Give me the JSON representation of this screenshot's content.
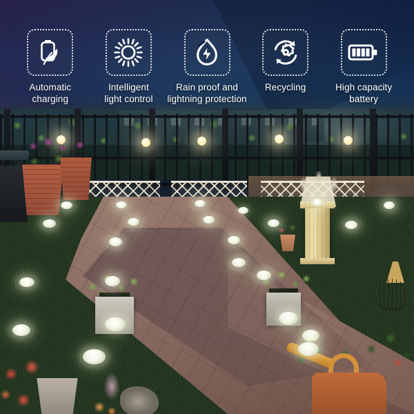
{
  "banner": {
    "type": "product-feature-banner",
    "product_context": "solar garden ground lights at night",
    "colors": {
      "header_top": "#16254a",
      "header_bottom": "#163358",
      "icon_stroke": "#ffffff",
      "label_text": "#ffffff",
      "box_border": "rgba(255,255,255,0.88)",
      "path_brick": "#8d6f66",
      "lawn_green": "#27401f",
      "light_glow": "#f5fad7"
    }
  },
  "features": [
    {
      "id": "automatic-charging",
      "icon": "battery-leaf-icon",
      "label": "Automatic\ncharging",
      "label_line1": "Automatic",
      "label_line2": "charging"
    },
    {
      "id": "intelligent-light-control",
      "icon": "sun-icon",
      "label": "Intelligent\nlight control",
      "label_line1": "Intelligent",
      "label_line2": "light control"
    },
    {
      "id": "rain-proof-lightning-protection",
      "icon": "droplet-lightning-icon",
      "label": "Rain proof and\nlightning protection",
      "label_line1": "Rain proof and",
      "label_line2": "lightning protection"
    },
    {
      "id": "recycling",
      "icon": "gear-recycle-icon",
      "label": "Recycling",
      "label_line1": "Recycling",
      "label_line2": ""
    },
    {
      "id": "high-capacity-battery",
      "icon": "battery-full-icon",
      "label": "High capacity\nbattery",
      "label_line1": "High capacity",
      "label_line2": "battery"
    }
  ],
  "photo": {
    "scene": "night garden walkway",
    "elements": [
      "wrought-iron fence",
      "white lattice border fence",
      "terracotta planters",
      "stone planters with shrubs",
      "brick paver path",
      "lawn",
      "roman column pedestal",
      "birdcage ornament",
      "orange watering can",
      "solar disc ground lights"
    ],
    "solar_light_count": 23
  }
}
